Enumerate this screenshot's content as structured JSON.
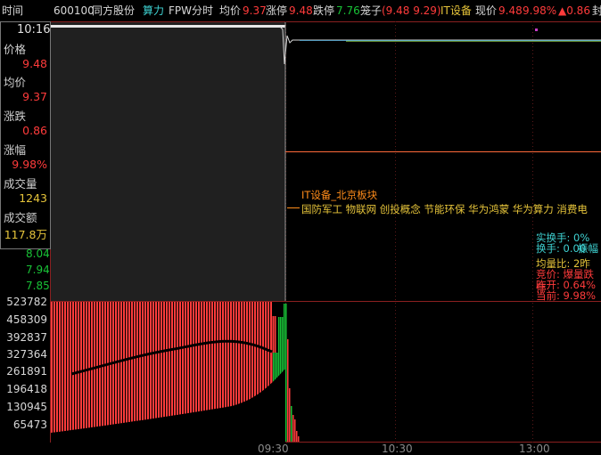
{
  "header": {
    "time_label": "时间",
    "code": "600100",
    "name": "同方股份",
    "tag": "算力",
    "period": "FPW分时",
    "avg_label": "均价",
    "avg_value": "9.37",
    "limit_up_label": "涨停",
    "limit_up_value": "9.48",
    "limit_down_label": "跌停",
    "limit_down_value": "7.76",
    "cage_label": "笼子",
    "cage_value": "(9.48 9.29)",
    "sector": "IT设备",
    "current_label": "现价",
    "current_value": "9.48",
    "pct_value": "9.98%",
    "change_value": "▲0.86",
    "tail": "封"
  },
  "panel": {
    "time": "10:16",
    "price_label": "价格",
    "price_value": "9.48",
    "avg_label": "均价",
    "avg_value": "9.37",
    "change_label": "涨跌",
    "change_value": "0.86",
    "pct_label": "涨幅",
    "pct_value": "9.98%",
    "vol_label": "成交量",
    "vol_value": "1243",
    "amount_label": "成交额",
    "amount_value": "117.8万"
  },
  "price_axis": [
    "8.04",
    "7.94",
    "7.85"
  ],
  "volume_axis": [
    "523782",
    "458309",
    "392837",
    "327364",
    "261891",
    "196418",
    "130945",
    "65473"
  ],
  "time_axis": [
    "09:30",
    "10:30",
    "13:00"
  ],
  "concepts": {
    "title": "IT设备_北京板块",
    "list": "国防军工 物联网 创投概念 节能环保 华为鸿蒙 华为算力 消费电"
  },
  "right_stats": {
    "real_turnover": "实换手: 0%",
    "turnover": "换手: 0.00",
    "turnover_tail": "振幅",
    "vol_ratio": "均量比: 2昨",
    "bid": "竞价: 爆量跌停",
    "yesterday": "昨开: 0.64%",
    "now": "当前: 9.98%"
  },
  "colors": {
    "up": "#ff3b3b",
    "down": "#19c337",
    "avg_line": "#e8e83a",
    "cyan": "#3fd3d3",
    "orange": "#ff8c1a",
    "purple": "#c83cc8",
    "yellow": "#e6c43a"
  }
}
